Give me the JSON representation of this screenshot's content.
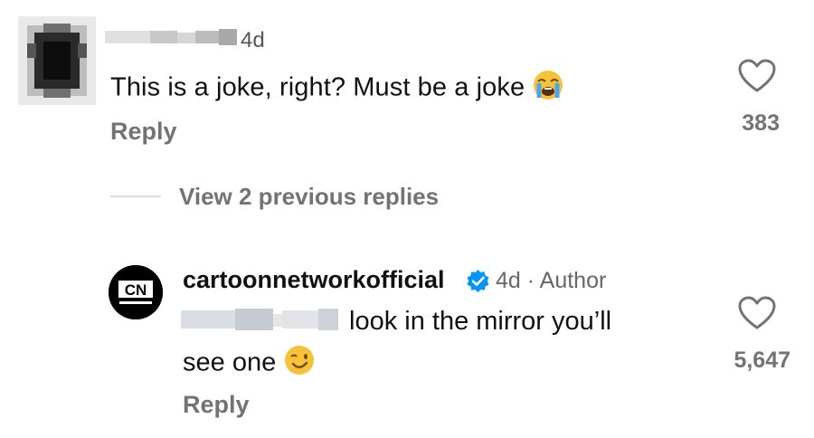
{
  "first_comment": {
    "time": "4d",
    "text": "This is a joke, right? Must be a joke",
    "emoji": "loudly-crying-face",
    "reply_label": "Reply",
    "likes": "383"
  },
  "view_previous_label": "View 2 previous replies",
  "second_comment": {
    "username": "cartoonnetworkofficial",
    "meta": "4d · Author",
    "text_line1": "look in the mirror you’ll",
    "text_line2": "see one",
    "emoji": "winking-face",
    "reply_label": "Reply",
    "likes": "5,647",
    "avatar_logo": "CN"
  },
  "colors": {
    "verified_blue": "#0095f6",
    "secondary_text": "#737373"
  }
}
